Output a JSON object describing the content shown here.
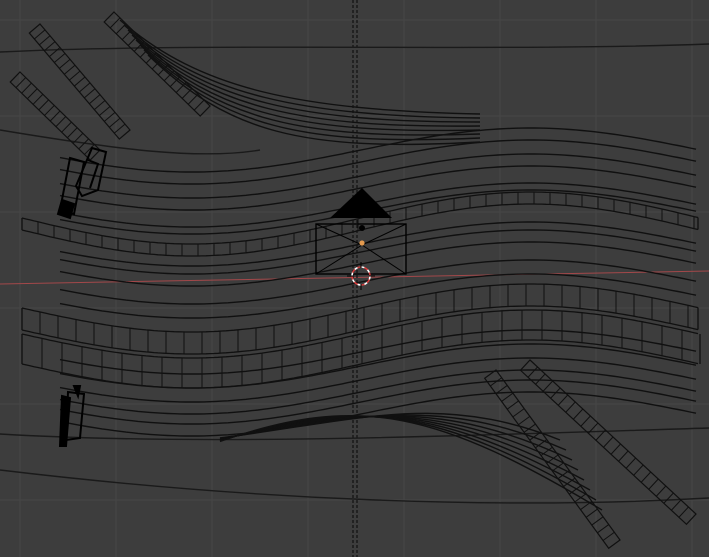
{
  "colors": {
    "background": "#3d3d3d",
    "grid": "#474747",
    "wire": "#101010",
    "x_axis": "#a3484a",
    "camera_fill": "#000000",
    "origin_dot": "#e39a4f",
    "cursor_ring": "#ffffff",
    "cursor_red": "#d23b3b"
  },
  "viewport": {
    "view": "3d-viewport-top-ortho",
    "icons": [
      "camera-object-icon",
      "3d-cursor-icon",
      "object-origin-icon",
      "car-mesh-icon"
    ]
  }
}
